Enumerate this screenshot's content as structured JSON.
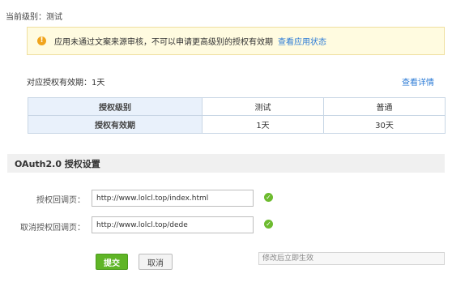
{
  "current_level": {
    "label": "当前级别：测试"
  },
  "notice": {
    "icon": "warning-icon",
    "text": "应用未通过文案来源审核，不可以申请更高级别的授权有效期",
    "link": "查看应用状态",
    "colors": {
      "background": "#fffbe0",
      "border": "#efdf9e",
      "icon": "#f0a41c"
    }
  },
  "validity": {
    "label": "对应授权有效期：1天",
    "detail_link": "查看详情"
  },
  "auth_table": {
    "rows": [
      [
        "授权级别",
        "测试",
        "普通"
      ],
      [
        "授权有效期",
        "1天",
        "30天"
      ]
    ]
  },
  "oauth": {
    "title": "OAuth2.0 授权设置",
    "callback_label": "授权回调页：",
    "callback_value": "http://www.lolcl.top/index.html",
    "cancel_callback_label": "取消授权回调页：",
    "cancel_callback_value": "http://www.lolcl.top/dede",
    "submit_label": "提交",
    "cancel_label": "取消",
    "hint": "修改后立即生效",
    "ok_icon": "check-circle-icon",
    "colors": {
      "submit": "#5fb526",
      "ok": "#6dbb2f",
      "link": "#2c7bd6"
    }
  }
}
